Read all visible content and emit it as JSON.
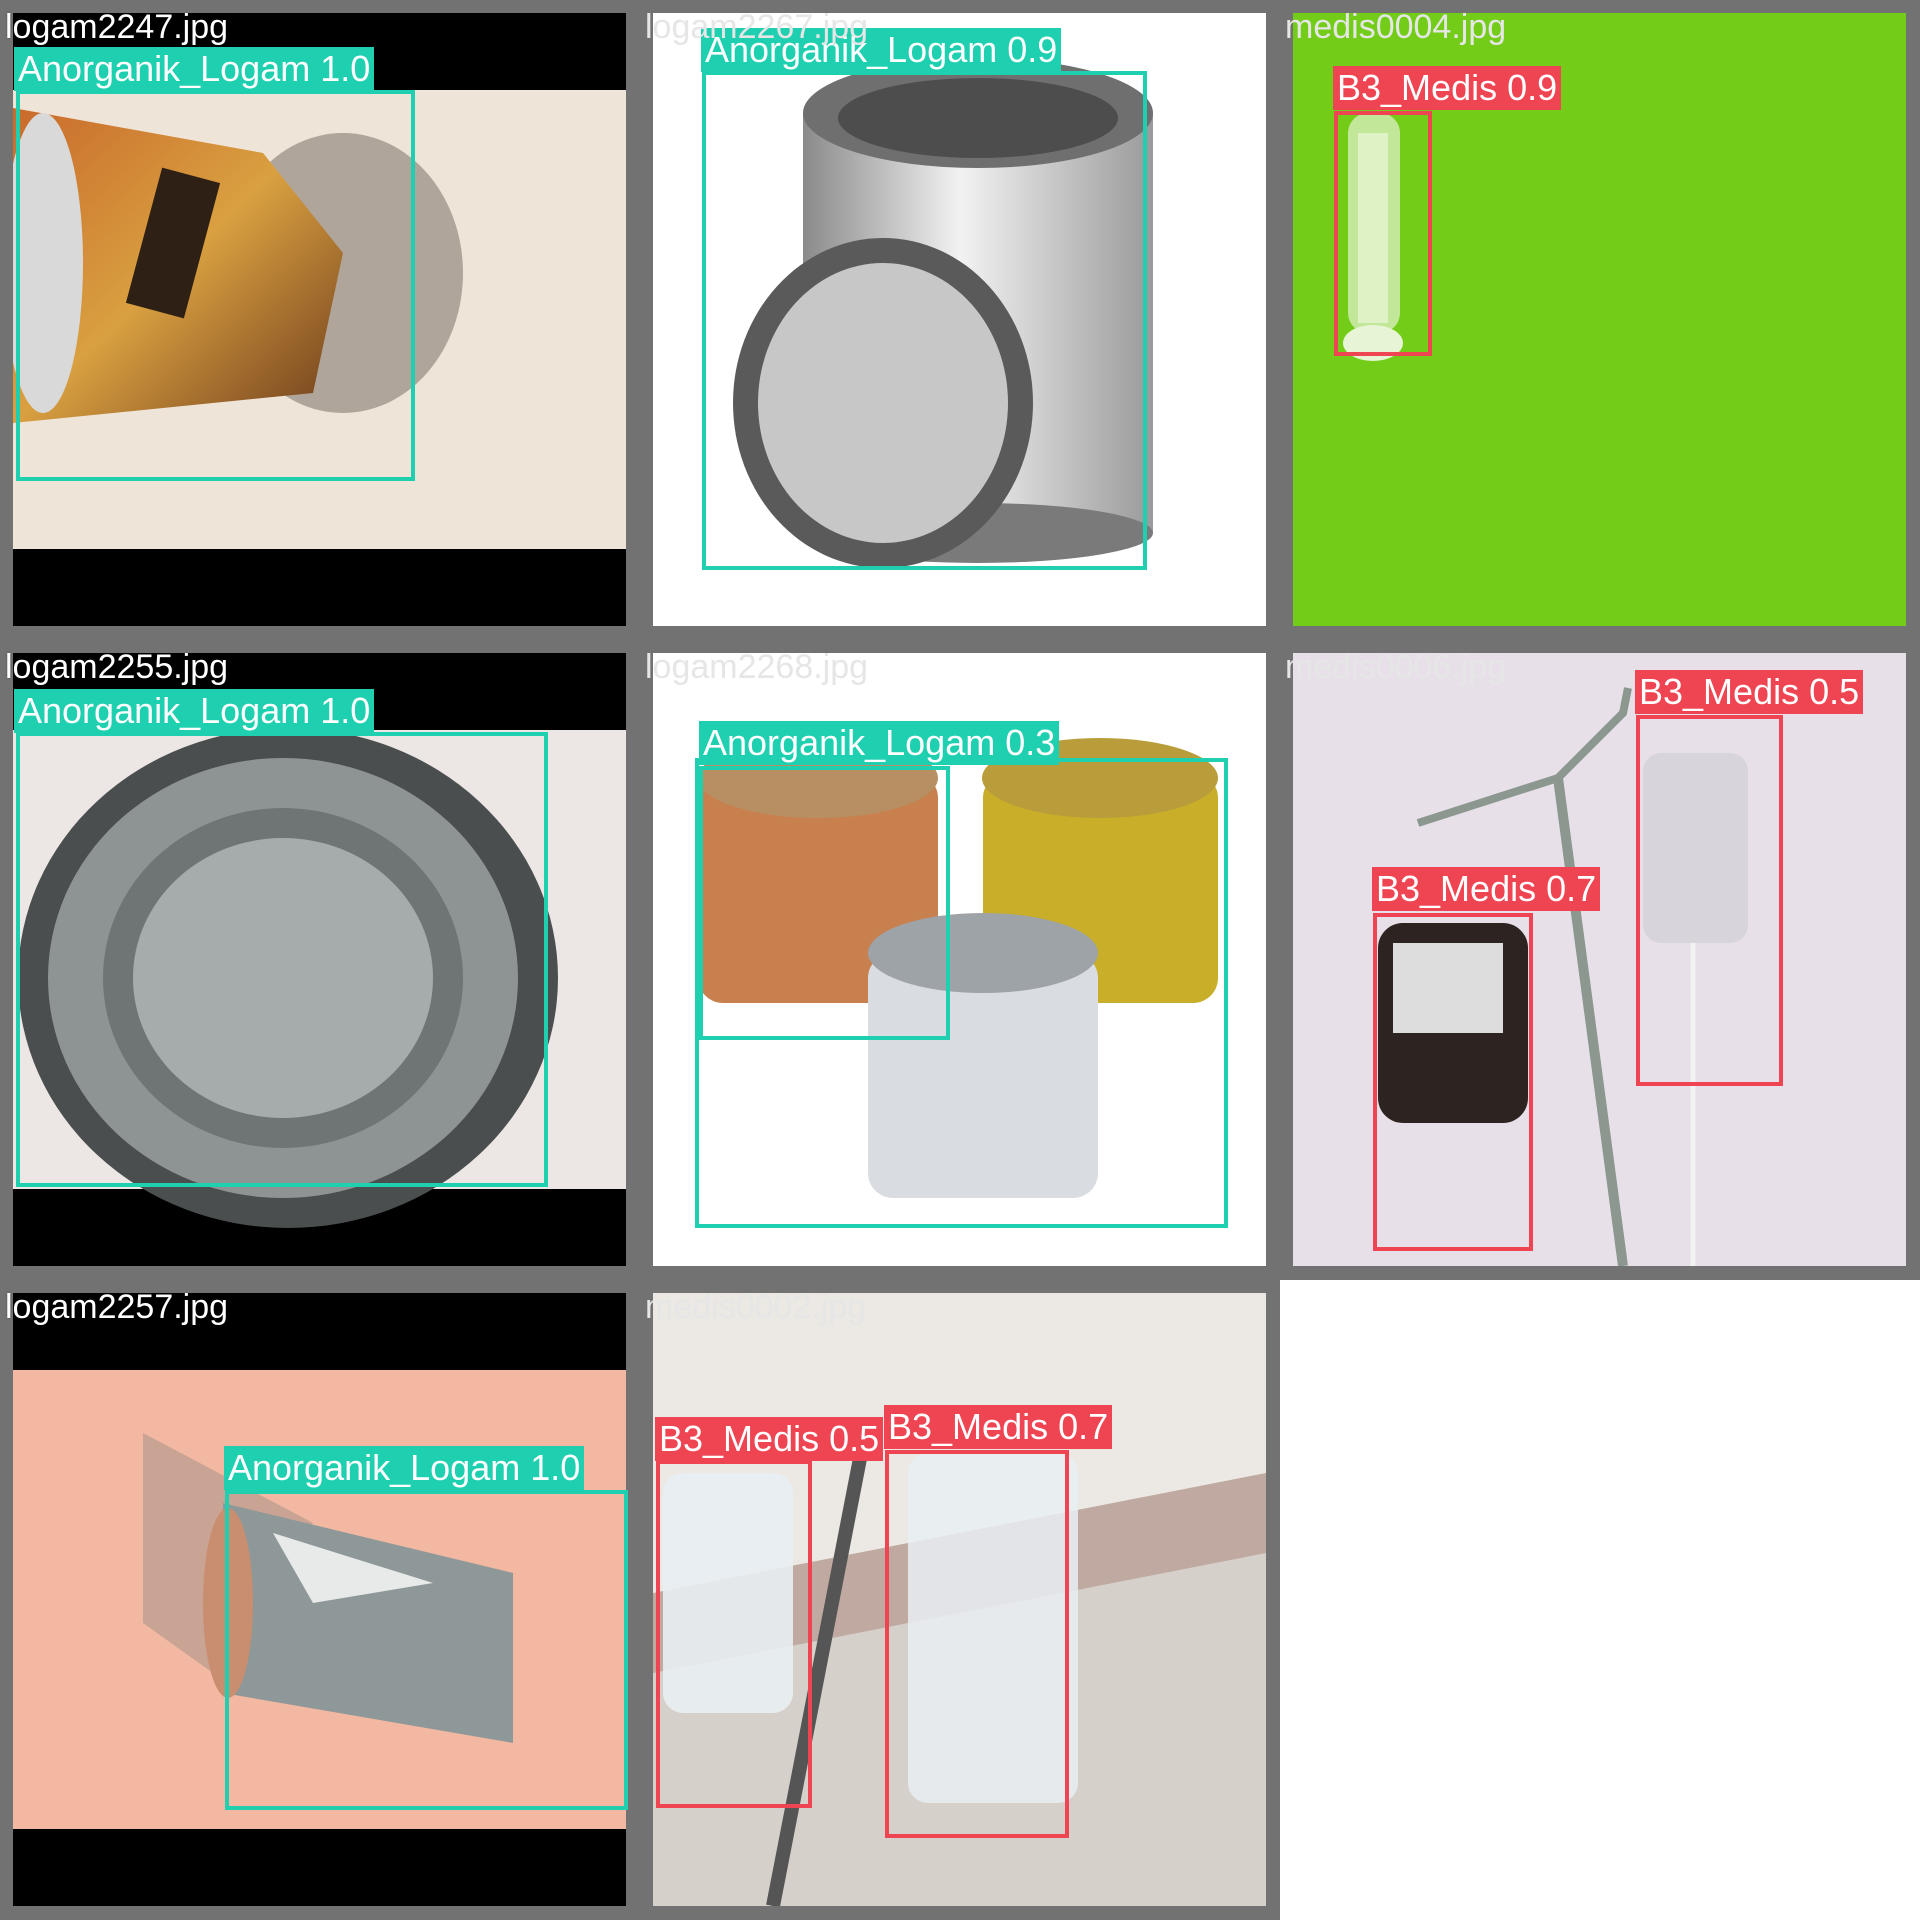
{
  "tiles": [
    {
      "filename": "logam2247.jpg",
      "detections": [
        {
          "label": "Anorganik_Logam 1.0"
        }
      ]
    },
    {
      "filename": "logam2267.jpg",
      "detections": [
        {
          "label": "Anorganik_Logam 0.9"
        }
      ]
    },
    {
      "filename": "medis0004.jpg",
      "detections": [
        {
          "label": "B3_Medis 0.9"
        }
      ]
    },
    {
      "filename": "logam2255.jpg",
      "detections": [
        {
          "label": "Anorganik_Logam 1.0"
        }
      ]
    },
    {
      "filename": "logam2268.jpg",
      "detections": [
        {
          "label": "Anorganik_Logam 0.3"
        }
      ]
    },
    {
      "filename": "medis0006.jpg",
      "detections": [
        {
          "label": "B3_Medis 0.5"
        },
        {
          "label": "B3_Medis 0.7"
        }
      ]
    },
    {
      "filename": "logam2257.jpg",
      "detections": [
        {
          "label": "Anorganik_Logam 1.0"
        }
      ]
    },
    {
      "filename": "medis0002.jpg",
      "detections": [
        {
          "label": "B3_Medis 0.5"
        },
        {
          "label": "B3_Medis 0.7"
        }
      ]
    }
  ],
  "colors": {
    "logam": "#1ecfb0",
    "medis": "#ef4451",
    "tile_border": "#727272"
  }
}
